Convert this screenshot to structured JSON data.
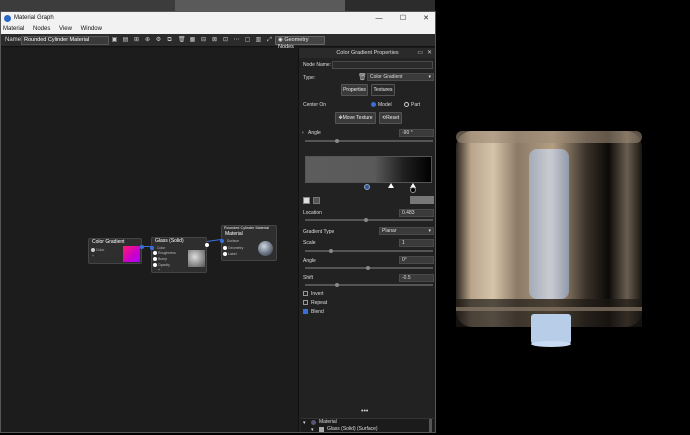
{
  "window": {
    "title": "Material Graph",
    "controls": {
      "minimize": "—",
      "maximize": "☐",
      "close": "✕"
    }
  },
  "menu": [
    "Material",
    "Nodes",
    "View",
    "Window"
  ],
  "toolbar": {
    "name_label": "Name:",
    "name_value": "Rounded Cylinder Material",
    "geometry_nodes_label": "Geometry Nodes"
  },
  "nodes": {
    "color_gradient": {
      "title": "Color Gradient",
      "ports": [
        "Color",
        "+"
      ]
    },
    "glass": {
      "title": "Glass (Solid)",
      "ports": [
        "Color",
        "Roughness",
        "Bump",
        "Opacity",
        "+"
      ]
    },
    "material": {
      "caption": "Rounded Cylinder Material",
      "title": "Material",
      "ports": [
        "Surface",
        "Geometry",
        "Label"
      ]
    }
  },
  "props": {
    "title": "Color Gradient Properties",
    "node_name_label": "Node Name:",
    "node_name_value": "",
    "type_label": "Type:",
    "type_value": "Color Gradient",
    "tab_properties": "Properties",
    "tab_textures": "Textures",
    "center_on_label": "Center On",
    "center_model": "Model",
    "center_part": "Part",
    "move_texture": "Move Texture",
    "reset": "Reset",
    "angle_label": "Angle",
    "angle_value": "-90 °",
    "location_label": "Location",
    "location_value": "0.483",
    "gradient_type_label": "Gradient Type",
    "gradient_type_value": "Planar",
    "scale_label": "Scale",
    "scale_value": "1",
    "angle2_label": "Angle",
    "angle2_value": "0°",
    "shift_label": "Shift",
    "shift_value": "-0.5",
    "invert_label": "Invert",
    "repeat_label": "Repeat",
    "blend_label": "Blend",
    "more": "•••",
    "tree": {
      "root": "Material",
      "child": "Glass (Solid) (Surface)"
    }
  },
  "colors": {
    "accent": "#3a6fd8",
    "wire": "#3a6fd8"
  }
}
